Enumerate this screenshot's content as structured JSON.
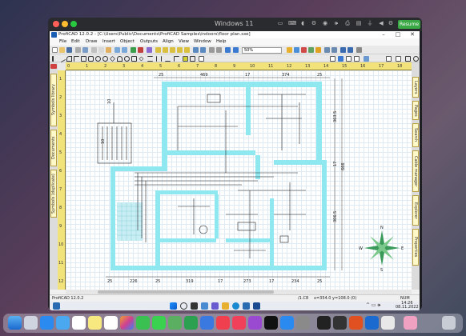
{
  "vm": {
    "title": "Windows 11",
    "resume_label": "Resume",
    "toolbar_icons": [
      "monitor-icon",
      "keyboard-icon",
      "mouse-icon",
      "settings-icon",
      "camera-icon",
      "volume-icon",
      "printer-icon",
      "folder-icon",
      "usb-icon",
      "back-icon",
      "sharing-icon"
    ]
  },
  "app": {
    "title": "ProfiCAD 12.0.2 - [C:\\Users\\Public\\Documents\\ProfiCAD Samples\\indoors\\floor plan.sxe]",
    "window_controls": {
      "minimize": "–",
      "maximize": "□",
      "close": "✕"
    },
    "menu": [
      "File",
      "Edit",
      "Draw",
      "Insert",
      "Object",
      "Outputs",
      "Align",
      "View",
      "Window",
      "Help"
    ],
    "zoom": "50%",
    "left_tabs": [
      "Symbols library",
      "Documents",
      "Symbols (duplicate)"
    ],
    "right_tabs": [
      "Layers",
      "Pages",
      "Search",
      "Cable manager",
      "Explorer",
      "Properties"
    ],
    "hruler_ticks": [
      "0",
      "1",
      "2",
      "3",
      "4",
      "5",
      "6",
      "7",
      "8",
      "9",
      "10",
      "11",
      "12",
      "13",
      "14",
      "15",
      "16",
      "17",
      "18"
    ],
    "vruler_ticks": [
      "1",
      "2",
      "3",
      "4",
      "5",
      "6",
      "7",
      "8",
      "9",
      "10",
      "11",
      "12"
    ],
    "dimensions": {
      "top": [
        "25",
        "469",
        "17",
        "374",
        "25"
      ],
      "bottom": [
        "25",
        "226",
        "25",
        "319",
        "17",
        "273",
        "17",
        "234",
        "25"
      ],
      "right": [
        "363.5",
        "17",
        "306.5"
      ],
      "right_total": "666",
      "left_top": "10",
      "left_mid": "10"
    },
    "compass": {
      "n": "N",
      "s": "S",
      "e": "E",
      "w": "W"
    },
    "status": {
      "left": "ProfiCAD 12.0.2",
      "layer": "/1.C8",
      "coords": "x=354.0  y=108.0 (0)",
      "mode": "NUM"
    }
  },
  "taskbar": {
    "time": "14:26",
    "date": "08.11.2022",
    "icons": [
      "start-icon",
      "search-icon",
      "task-view-icon",
      "widgets-icon",
      "chat-icon",
      "file-explorer-icon",
      "edge-icon",
      "store-icon",
      "proficad-icon"
    ]
  },
  "dock": {
    "icons": [
      "finder-icon",
      "launchpad-icon",
      "safari-icon",
      "mail-icon",
      "calendar-icon",
      "notes-icon",
      "reminders-icon",
      "photos-icon",
      "facetime-icon",
      "messages-icon",
      "maps-icon",
      "numbers-icon",
      "keynote-icon",
      "news-icon",
      "music-icon",
      "podcasts-icon",
      "tv-icon",
      "appstore-icon",
      "settings-icon",
      "terminal-icon",
      "activity-icon",
      "office-icon",
      "windows-icon",
      "vm-icon",
      "browser-icon",
      "trash-icon"
    ]
  }
}
